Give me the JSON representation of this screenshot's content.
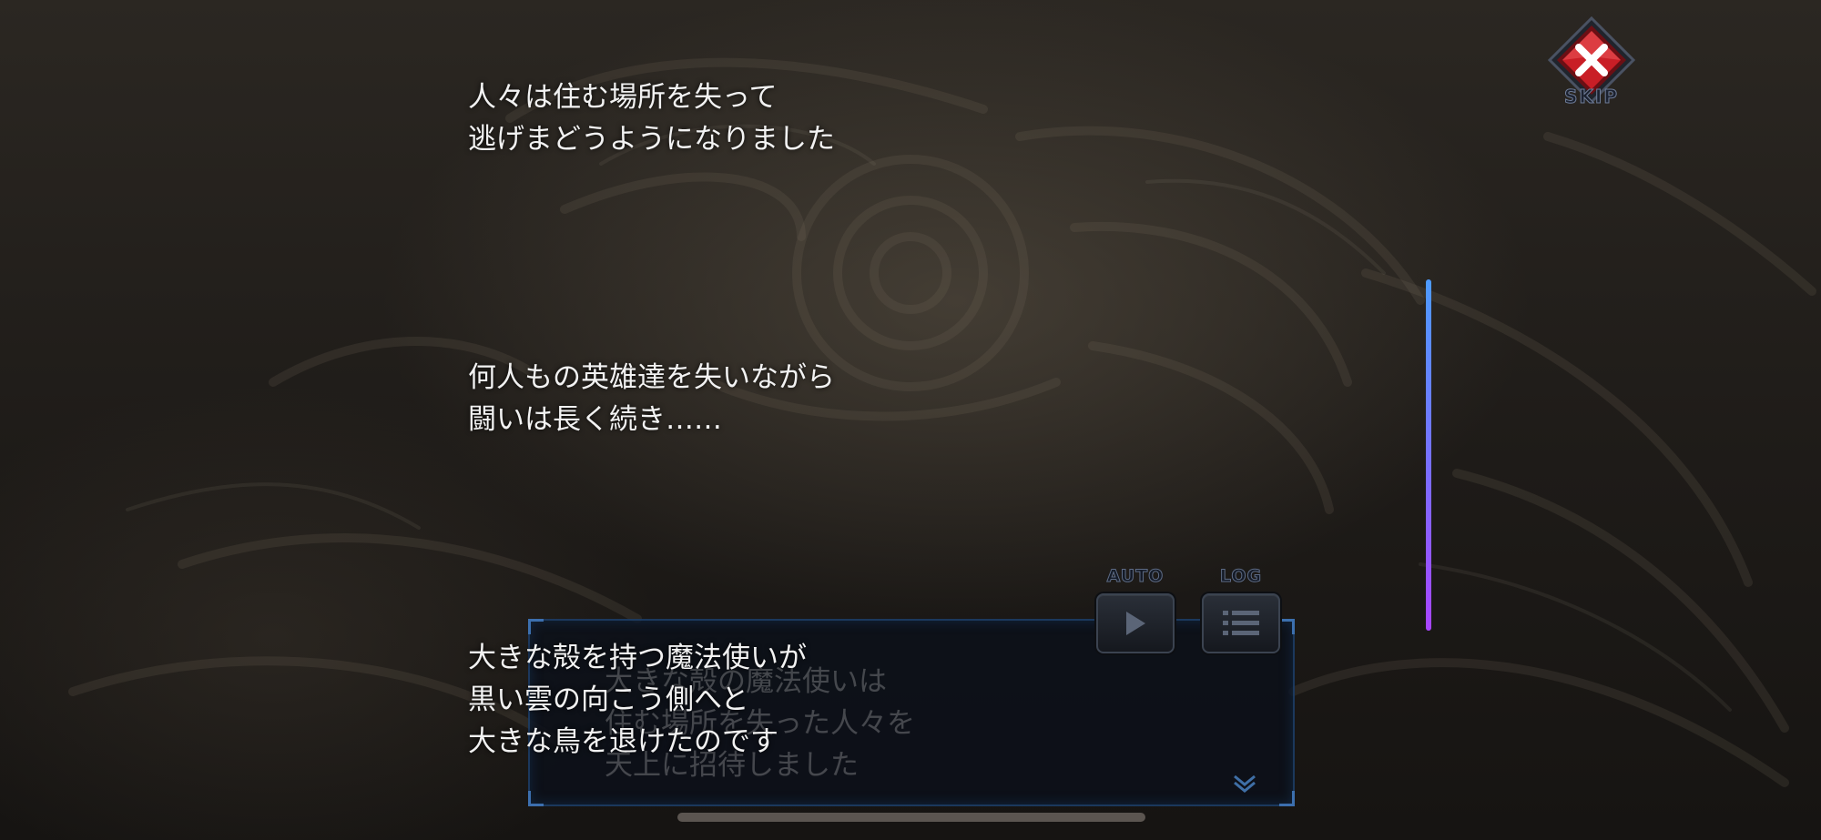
{
  "narration": [
    {
      "lines": [
        "人々は住む場所を失って",
        "逃げまどうようになりました"
      ]
    },
    {
      "lines": [
        "何人もの英雄達を失いながら",
        "闘いは長く続き……"
      ]
    },
    {
      "lines": [
        "大きな殻を持つ魔法使いが",
        "黒い雲の向こう側へと",
        "大きな鳥を退けたのです"
      ]
    }
  ],
  "skip": {
    "label": "SKIP",
    "icon": "close-x-icon",
    "color": "#d8262d"
  },
  "controls": {
    "auto": {
      "label": "AUTO",
      "icon": "play-icon"
    },
    "log": {
      "label": "LOG",
      "icon": "list-icon"
    }
  },
  "message_box": {
    "lines": [
      "大きな殻の魔法使いは",
      "住む場所を失った人々を",
      "天上に招待しました"
    ],
    "next_icon": "chevron-double-down-icon"
  },
  "progress": {
    "accent_top": "#4d9bff",
    "accent_bottom": "#a844ff"
  }
}
